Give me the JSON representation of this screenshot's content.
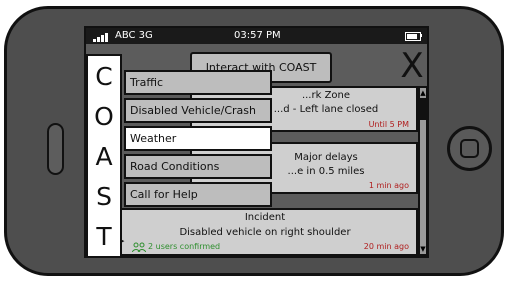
{
  "status_bar": {
    "carrier": "ABC 3G",
    "time": "03:57 PM",
    "battery_level": 0.85
  },
  "header": {
    "interact_label": "Interact with COAST",
    "close_symbol": "X"
  },
  "coast_letters": [
    "C",
    "O",
    "A",
    "S",
    "T"
  ],
  "menu": {
    "items": [
      {
        "label": "Traffic"
      },
      {
        "label": "Disabled Vehicle/Crash"
      },
      {
        "label": "Weather"
      },
      {
        "label": "Road Conditions"
      },
      {
        "label": "Call for Help"
      }
    ],
    "selected": "Weather"
  },
  "incidents": [
    {
      "title": "...rk Zone",
      "desc": "...d - Left lane closed",
      "time": "Until 5 PM"
    },
    {
      "title": "Major delays",
      "desc": "...e in 0.5 miles",
      "time": "1 min ago"
    },
    {
      "title": "Incident",
      "desc": "Disabled vehicle on right shoulder",
      "confirmed": "2 users confirmed",
      "time": "20 min ago"
    }
  ],
  "colors": {
    "time_red": "#b02020",
    "confirm_green": "#2f8f2f",
    "menu_gray": "#bdbdbd",
    "screen_gray": "#5c5c5c"
  }
}
